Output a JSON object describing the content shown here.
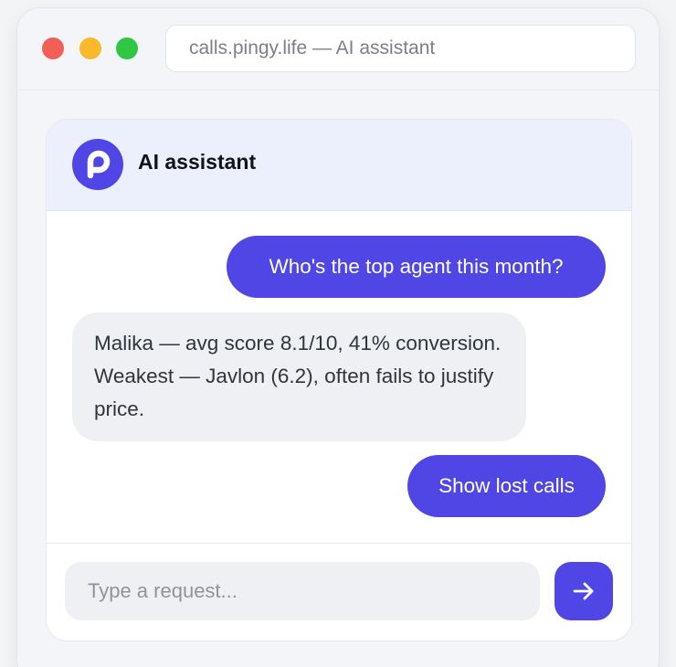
{
  "window": {
    "url": "calls.pingy.life — AI assistant"
  },
  "assistant": {
    "name": "AI assistant",
    "avatar_icon": "pingy-p-logo-icon"
  },
  "messages": [
    {
      "role": "user",
      "text": "Who's the top agent this month?"
    },
    {
      "role": "assistant",
      "text": "Malika — avg score 8.1/10, 41% conversion. Weakest — Javlon (6.2), often fails to justify price."
    },
    {
      "role": "user",
      "text": "Show lost calls"
    }
  ],
  "composer": {
    "placeholder": "Type a request...",
    "value": "",
    "send_icon": "arrow-right-icon"
  },
  "colors": {
    "accent": "#4f46e5",
    "header_bg": "#ecf0fd",
    "bot_bubble": "#eef0f4",
    "traffic_red": "#f25f57",
    "traffic_yellow": "#f8b92a",
    "traffic_green": "#2fc744"
  }
}
